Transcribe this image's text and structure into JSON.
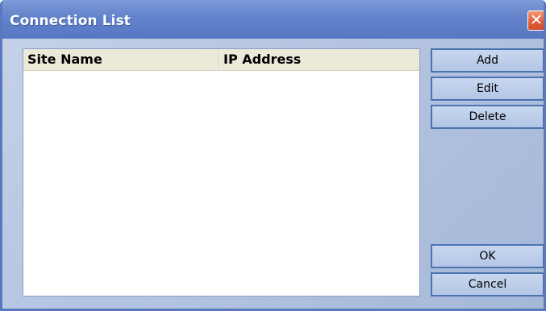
{
  "window": {
    "title": "Connection List",
    "close_glyph": "✕"
  },
  "list": {
    "columns": [
      {
        "label": "Site Name"
      },
      {
        "label": "IP Address"
      }
    ],
    "rows": []
  },
  "buttons": {
    "add": "Add",
    "edit": "Edit",
    "delete": "Delete",
    "ok": "OK",
    "cancel": "Cancel"
  },
  "icons": {
    "close": "close-icon"
  },
  "colors": {
    "titlebar": "#6283cb",
    "close_button": "#e2603a",
    "client_area": "#b5c5e1",
    "list_header": "#ece9d8",
    "button_border": "#4a73b0"
  }
}
